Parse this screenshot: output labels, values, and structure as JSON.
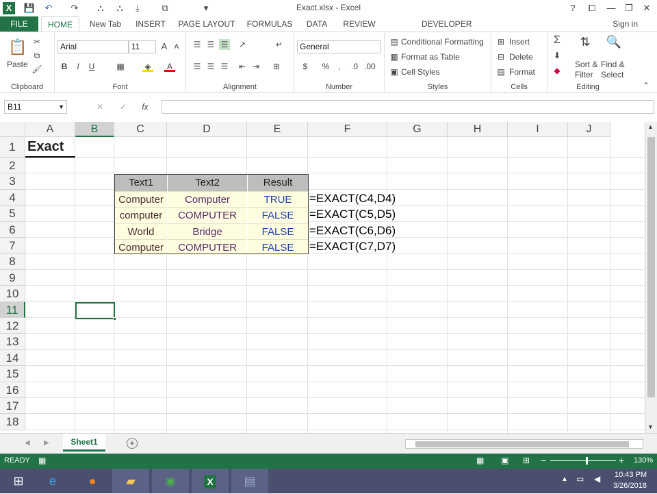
{
  "window": {
    "title": "Exact.xlsx - Excel",
    "help": "?",
    "minimize": "—",
    "restore": "❐",
    "close": "✕"
  },
  "qat": {
    "excel_icon": "X",
    "save": "💾",
    "undo": "↶",
    "redo": "↷"
  },
  "tabs": [
    "FILE",
    "HOME",
    "New Tab",
    "INSERT",
    "PAGE LAYOUT",
    "FORMULAS",
    "DATA",
    "REVIEW",
    "DEVELOPER"
  ],
  "signin": "Sign in",
  "ribbon": {
    "clipboard": {
      "label": "Clipboard",
      "paste": "Paste"
    },
    "font": {
      "label": "Font",
      "name": "Arial",
      "size": "11",
      "bold": "B",
      "italic": "I",
      "underline": "U",
      "grow": "A",
      "shrink": "A"
    },
    "alignment": {
      "label": "Alignment"
    },
    "number": {
      "label": "Number",
      "format": "General",
      "currency": "$",
      "percent": "%",
      "comma": ","
    },
    "styles": {
      "label": "Styles",
      "conditional": "Conditional Formatting",
      "table": "Format as Table",
      "cell": "Cell Styles"
    },
    "cells": {
      "label": "Cells",
      "insert": "Insert",
      "delete": "Delete",
      "format": "Format"
    },
    "editing": {
      "label": "Editing",
      "sigma": "Σ",
      "sort1": "Sort &",
      "sort2": "Filter",
      "find1": "Find &",
      "find2": "Select"
    }
  },
  "formula_bar": {
    "namebox": "B11",
    "cancel": "✕",
    "enter": "✓",
    "fx": "fx",
    "value": ""
  },
  "columns": [
    "A",
    "B",
    "C",
    "D",
    "E",
    "F",
    "G",
    "H",
    "I",
    "J"
  ],
  "rows": [
    "1",
    "2",
    "3",
    "4",
    "5",
    "6",
    "7",
    "8",
    "9",
    "10",
    "11",
    "12",
    "13",
    "14",
    "15",
    "16",
    "17",
    "18"
  ],
  "sheet": {
    "title": "Exact",
    "headers": [
      "Text1",
      "Text2",
      "Result"
    ],
    "data": [
      [
        "Computer",
        "Computer",
        "TRUE",
        "=EXACT(C4,D4)"
      ],
      [
        "computer",
        "COMPUTER",
        "FALSE",
        "=EXACT(C5,D5)"
      ],
      [
        "World",
        "Bridge",
        "FALSE",
        "=EXACT(C6,D6)"
      ],
      [
        "Computer",
        "COMPUTER",
        "FALSE",
        "=EXACT(C7,D7)"
      ]
    ]
  },
  "sheettab": "Sheet1",
  "status": {
    "ready": "READY",
    "zoom": "130%"
  },
  "taskbar": {
    "time": "10:43 PM",
    "date": "3/26/2018"
  },
  "colors": {
    "accent": "#217346",
    "header_fill": "#bdbdbd",
    "data_fill": "#fffde0",
    "result_text": "#1f3fa8"
  }
}
